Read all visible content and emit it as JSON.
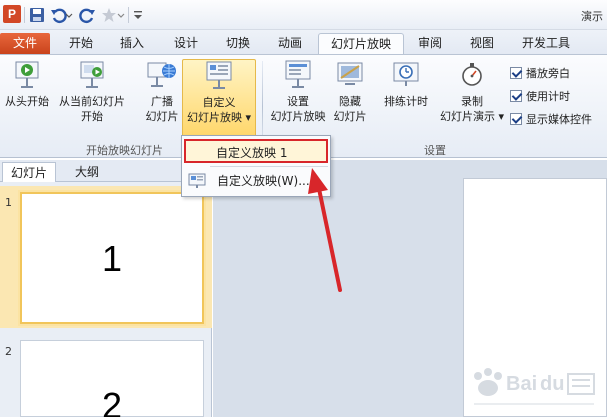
{
  "window": {
    "title": "演示"
  },
  "tabs": {
    "file": "文件",
    "items": [
      "开始",
      "插入",
      "设计",
      "切换",
      "动画",
      "幻灯片放映",
      "审阅",
      "视图",
      "开发工具"
    ],
    "active": "幻灯片放映"
  },
  "ribbon": {
    "from_beginning": "从头开始",
    "from_current_line1": "从当前幻灯片",
    "from_current_line2": "开始",
    "broadcast_line1": "广播",
    "broadcast_line2": "幻灯片",
    "custom_line1": "自定义",
    "custom_line2": "幻灯片放映",
    "custom_arrow": "▾",
    "setup_line1": "设置",
    "setup_line2": "幻灯片放映",
    "hide_line1": "隐藏",
    "hide_line2": "幻灯片",
    "rehearse": "排练计时",
    "record_line1": "录制",
    "record_line2": "幻灯片演示",
    "record_arrow": "▾",
    "chk_narration": "播放旁白",
    "chk_timings": "使用计时",
    "chk_media": "显示媒体控件",
    "group_start": "开始放映幻灯片",
    "group_setup": "设置"
  },
  "menu": {
    "item1": "自定义放映 1",
    "item2": "自定义放映(W)..."
  },
  "pane": {
    "tab_slides": "幻灯片",
    "tab_outline": "大纲",
    "slides": [
      {
        "number": "1",
        "content": "1"
      },
      {
        "number": "2",
        "content": "2"
      }
    ]
  },
  "colors": {
    "file_tab": "#d24726",
    "highlight": "#ffd76b",
    "annotation_red": "#d8262a"
  }
}
